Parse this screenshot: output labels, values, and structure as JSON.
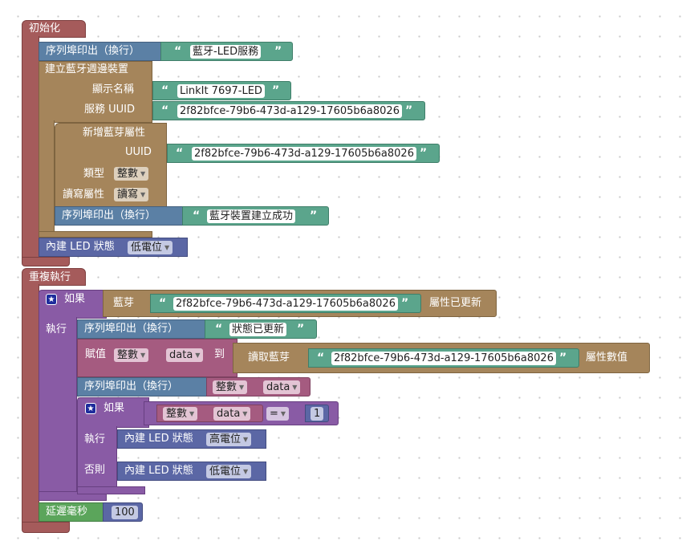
{
  "setup": {
    "label": "初始化",
    "serial_print_1": {
      "label": "序列埠印出（換行）",
      "text": "藍牙-LED服務"
    },
    "peripheral": {
      "label": "建立藍牙週邊裝置",
      "name_label": "顯示名稱",
      "name_value": "LinkIt 7697-LED",
      "service_label": "服務 UUID",
      "service_uuid": "2f82bfce-79b6-473d-a129-17605b6a8026",
      "attribute": {
        "label": "新增藍芽屬性",
        "uuid_label": "UUID",
        "uuid_value": "2f82bfce-79b6-473d-a129-17605b6a8026",
        "type_label": "類型",
        "type_value": "整數",
        "rw_label": "讀寫屬性",
        "rw_value": "讀寫"
      },
      "serial_print_2": {
        "label": "序列埠印出（換行）",
        "text": "藍牙裝置建立成功"
      }
    },
    "led": {
      "label": "內建 LED 狀態",
      "value": "低電位"
    }
  },
  "loop": {
    "label": "重複執行",
    "if1": {
      "if_label": "如果",
      "do_label": "執行",
      "cond_prefix": "藍芽",
      "cond_uuid": "2f82bfce-79b6-473d-a129-17605b6a8026",
      "cond_suffix": "屬性已更新"
    },
    "print_updated": {
      "label": "序列埠印出（換行）",
      "text": "狀態已更新"
    },
    "assign": {
      "label": "賦值",
      "type": "整數",
      "var": "data",
      "to_label": "到",
      "read_prefix": "讀取藍芽",
      "read_uuid": "2f82bfce-79b6-473d-a129-17605b6a8026",
      "read_suffix": "屬性數值"
    },
    "print_data": {
      "label": "序列埠印出（換行）",
      "type": "整數",
      "var": "data"
    },
    "if2": {
      "if_label": "如果",
      "do_label": "執行",
      "else_label": "否則",
      "type": "整數",
      "var": "data",
      "op": "=",
      "value": "1",
      "led_high": {
        "label": "內建 LED 狀態",
        "value": "高電位"
      },
      "led_low": {
        "label": "內建 LED 狀態",
        "value": "低電位"
      }
    },
    "delay": {
      "label": "延遲毫秒",
      "value": "100"
    }
  },
  "icons": {
    "quote_open": "“",
    "quote_close": "”",
    "dropdown": "dropdown-arrow-icon",
    "mutator": "gear-icon"
  },
  "colors": {
    "procedure": "#a55b5b",
    "serial": "#5b80a5",
    "text": "#5ba58c",
    "ble": "#a5855b",
    "led": "#5b67a5",
    "logic": "#895ba5",
    "variable": "#a55b80",
    "delay": "#5ba55b"
  }
}
